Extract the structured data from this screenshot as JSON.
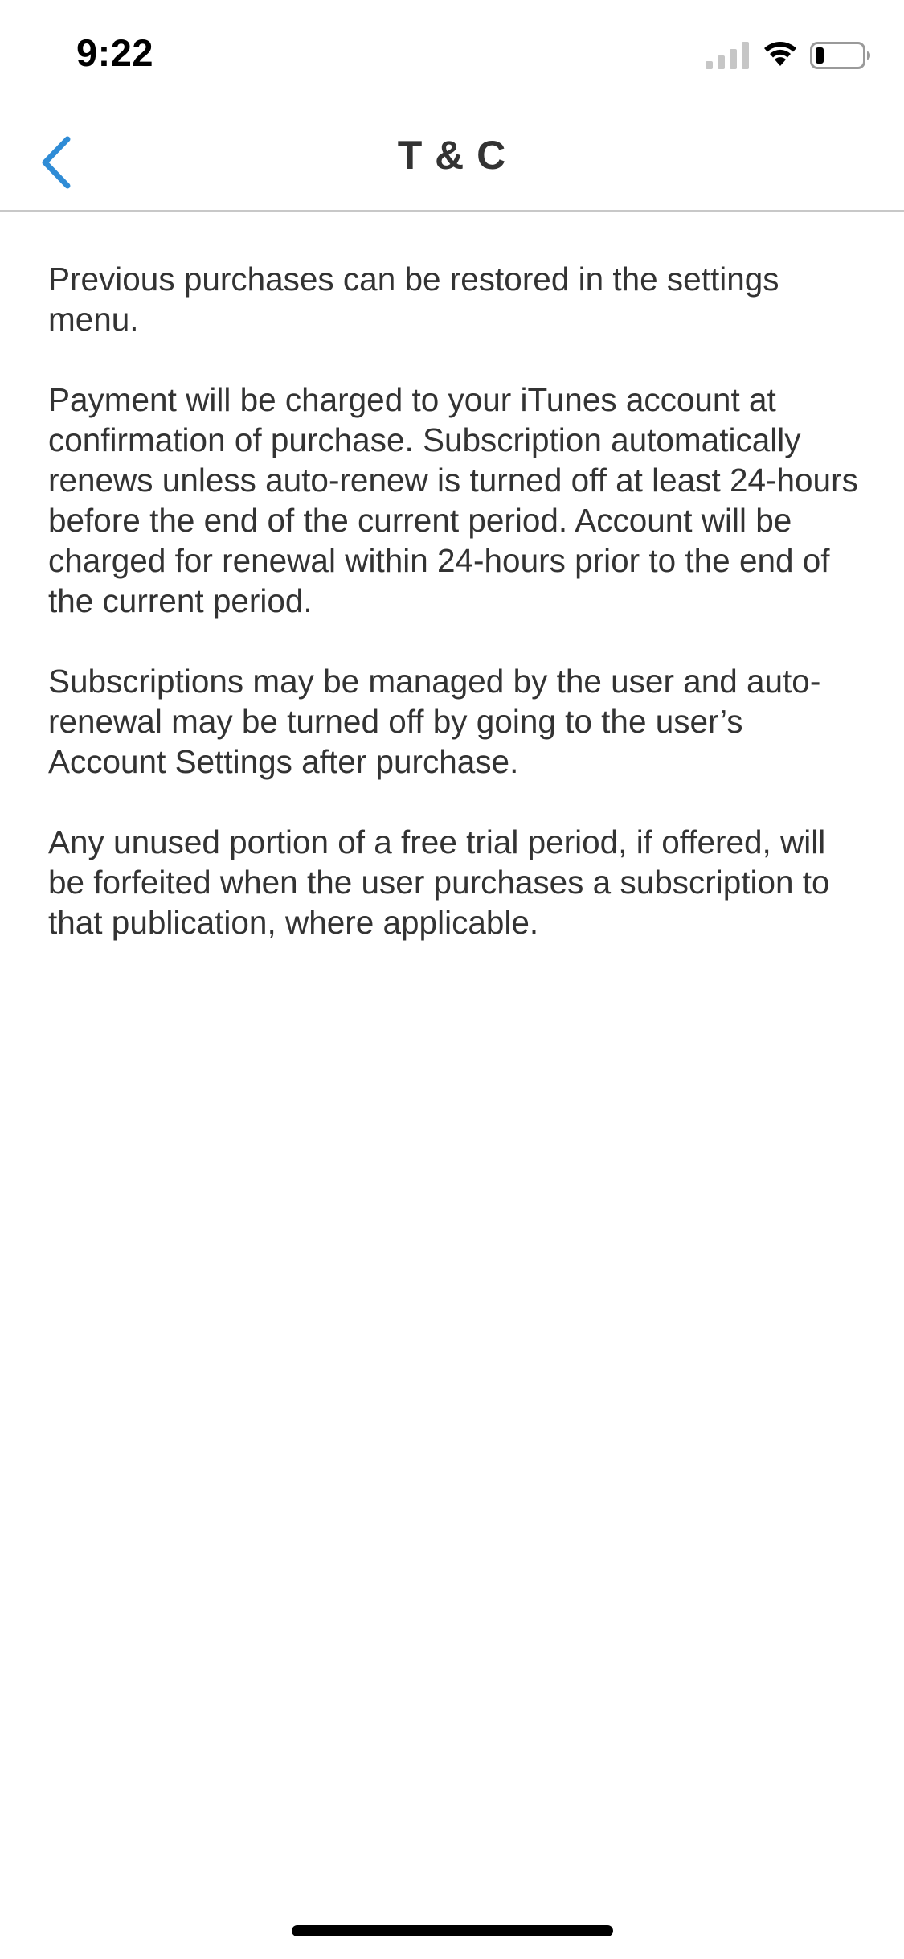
{
  "status_bar": {
    "time": "9:22",
    "icons": [
      "signal-icon",
      "wifi-icon",
      "battery-icon"
    ]
  },
  "nav": {
    "title": "T & C",
    "back_icon": "chevron-left-icon",
    "accent_color": "#2f8cd6"
  },
  "content": {
    "paragraphs": [
      "Previous purchases can be restored in the settings menu.",
      "Payment will be charged to your iTunes account at confirmation of purchase. Subscription automatically renews unless auto-renew is turned off at least 24-hours before the end of the current period. Account will be charged for renewal within 24-hours prior to the end of the current period.",
      "Subscriptions may be managed by the user and auto-renewal may be turned off by going to the user’s Account Settings after purchase.",
      "Any unused portion of a free trial period, if offered, will be forfeited when the user purchases a subscription to that publication, where applicable."
    ]
  }
}
